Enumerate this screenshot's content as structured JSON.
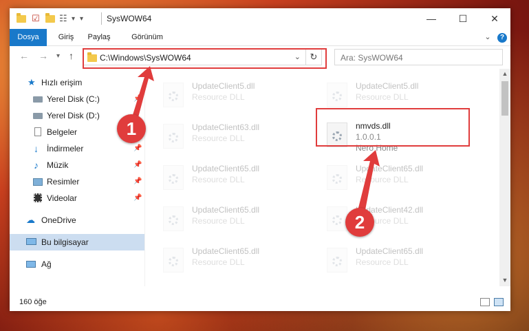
{
  "window": {
    "title": "SysWOW64",
    "controls": {
      "minimize": "—",
      "maximize": "☐",
      "close": "✕"
    }
  },
  "ribbon": {
    "tabs": [
      "Dosya",
      "Giriş",
      "Paylaş",
      "Görünüm"
    ],
    "expand": "⌄",
    "help": "?"
  },
  "address": {
    "path": "C:\\Windows\\SysWOW64",
    "search_placeholder": "Ara: SysWOW64"
  },
  "nav": {
    "quick_access": "Hızlı erişim",
    "items": [
      {
        "label": "Yerel Disk (C:)",
        "icon": "drive-icon",
        "pinned": true
      },
      {
        "label": "Yerel Disk (D:)",
        "icon": "drive-icon",
        "pinned": false
      },
      {
        "label": "Belgeler",
        "icon": "documents-icon",
        "pinned": true
      },
      {
        "label": "İndirmeler",
        "icon": "downloads-icon",
        "pinned": true
      },
      {
        "label": "Müzik",
        "icon": "music-icon",
        "pinned": true
      },
      {
        "label": "Resimler",
        "icon": "pictures-icon",
        "pinned": true
      },
      {
        "label": "Videolar",
        "icon": "videos-icon",
        "pinned": true
      }
    ],
    "onedrive": "OneDrive",
    "this_pc": "Bu bilgisayar",
    "network": "Ağ"
  },
  "files": {
    "left": [
      {
        "name": "UpdateClient5.dll",
        "type": "Resource DLL"
      },
      {
        "name": "UpdateClient63.dll",
        "type": "Resource DLL"
      },
      {
        "name": "UpdateClient65.dll",
        "type": "Resource DLL"
      },
      {
        "name": "UpdateClient65.dll",
        "type": "Resource DLL"
      },
      {
        "name": "UpdateClient65.dll",
        "type": "Resource DLL"
      }
    ],
    "right_top": {
      "name": "UpdateClient5.dll",
      "type": "Resource DLL"
    },
    "highlighted": {
      "name": "nmvds.dll",
      "version": "1.0.0.1",
      "company": "Nero Home"
    },
    "right": [
      {
        "name": "UpdateClient65.dll",
        "type": "Resource DLL"
      },
      {
        "name": "UpdateClient42.dll",
        "type": "Resource DLL"
      },
      {
        "name": "UpdateClient65.dll",
        "type": "Resource DLL"
      }
    ]
  },
  "status": {
    "count": "160 öğe"
  },
  "annotations": {
    "badge1": "1",
    "badge2": "2"
  },
  "colors": {
    "accent": "#1979ca",
    "highlight": "#e03c3c",
    "selection": "#ccddf0"
  }
}
